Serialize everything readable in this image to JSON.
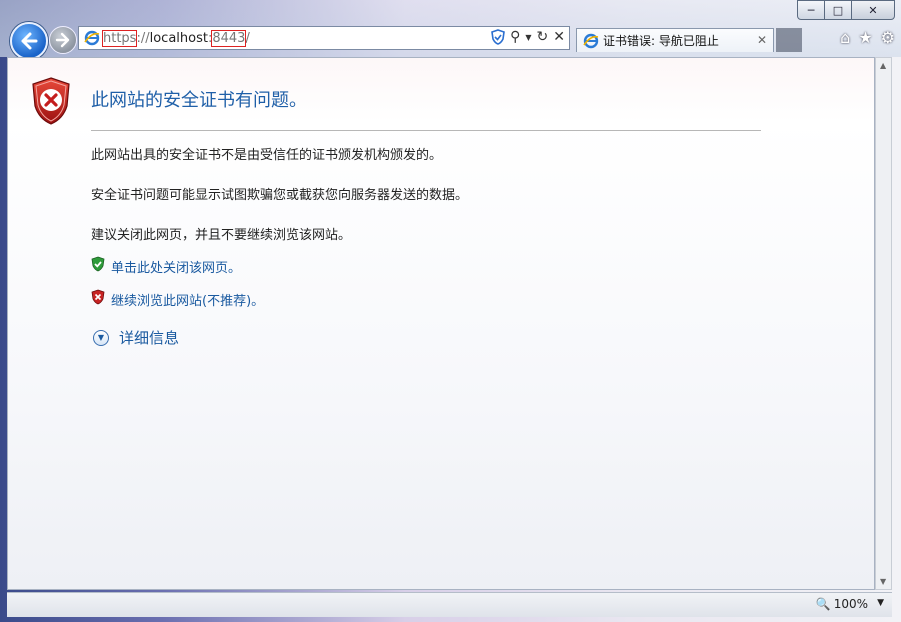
{
  "browser": {
    "url_scheme": "https",
    "url_sep": "://",
    "url_host": "localhost",
    "url_colon": ":",
    "url_port": "8443",
    "url_path": "/",
    "tab_title": "证书错误: 导航已阻止",
    "zoom": "100%"
  },
  "page": {
    "title": "此网站的安全证书有问题。",
    "para1": "此网站出具的安全证书不是由受信任的证书颁发机构颁发的。",
    "para2": "安全证书问题可能显示试图欺骗您或截获您向服务器发送的数据。",
    "para3": "建议关闭此网页，并且不要继续浏览该网站。",
    "link_close": "单击此处关闭该网页。",
    "link_continue": "继续浏览此网站(不推荐)。",
    "more_info": "详细信息"
  },
  "icons": {
    "back": "back-arrow-icon",
    "forward": "forward-arrow-icon",
    "home": "home-icon",
    "favorites": "star-icon",
    "tools": "gear-icon"
  }
}
